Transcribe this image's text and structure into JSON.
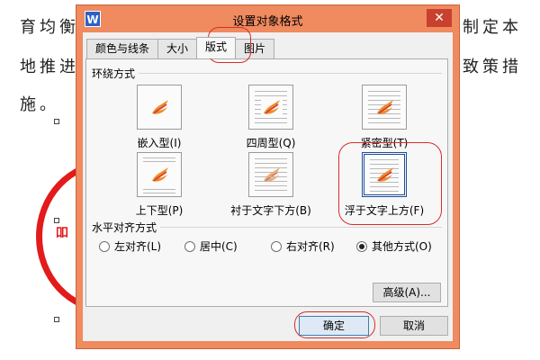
{
  "document": {
    "line1_left": "育均衡",
    "line1_right": "制定本",
    "line2_left": "地推进",
    "line2_right": "致策措",
    "line3": "施。"
  },
  "dialog": {
    "title": "设置对象格式",
    "app_icon": "W",
    "close": "✕",
    "tabs": [
      {
        "label": "颜色与线条",
        "active": false
      },
      {
        "label": "大小",
        "active": false
      },
      {
        "label": "版式",
        "active": true
      },
      {
        "label": "图片",
        "active": false
      }
    ],
    "wrap_section": "环绕方式",
    "wrap_options": [
      {
        "label": "嵌入型(I)",
        "selected": false
      },
      {
        "label": "四周型(Q)",
        "selected": false
      },
      {
        "label": "紧密型(T)",
        "selected": false
      },
      {
        "label": "上下型(P)",
        "selected": false
      },
      {
        "label": "衬于文字下方(B)",
        "selected": false
      },
      {
        "label": "浮于文字上方(F)",
        "selected": true
      }
    ],
    "align_section": "水平对齐方式",
    "align_options": [
      {
        "label": "左对齐(L)",
        "checked": false
      },
      {
        "label": "居中(C)",
        "checked": false
      },
      {
        "label": "右对齐(R)",
        "checked": false
      },
      {
        "label": "其他方式(O)",
        "checked": true
      }
    ],
    "advanced_button": "高级(A)...",
    "ok_button": "确定",
    "cancel_button": "取消"
  },
  "colors": {
    "window_frame": "#f08a5f",
    "annotation": "#d62c2c",
    "stamp": "#e21b1b"
  }
}
